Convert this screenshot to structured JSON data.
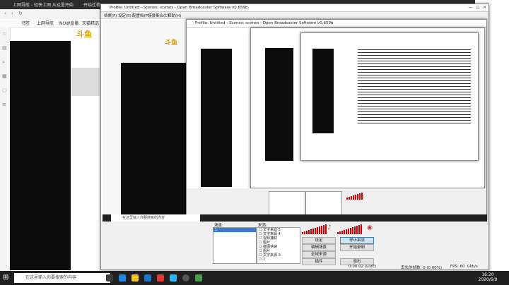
{
  "browser": {
    "tab_label": "上网导航 - 轻快上网 从这里开始",
    "tab_label2": "开始迁移",
    "bookmarks": [
      "书签",
      "上网导航",
      "NOW直播",
      "天猫精选"
    ],
    "logo": "斗鱼"
  },
  "obs": {
    "title": "Profile: Untitled - Scenes: scenes - Open Broadcaster Software v0.659b",
    "menu": [
      "档案(F)",
      "设定(S)",
      "配置档(P)",
      "场景集合(C)",
      "帮助(H)"
    ],
    "scenes_label": "场景:",
    "sources_label": "来源:",
    "scene_item": "1",
    "sources": [
      "文字来源 5",
      "文字来源 4",
      "视频捕获",
      "图片",
      "截图快速",
      "图片",
      "文字来源 3",
      "1",
      "文字来源 2"
    ],
    "buttons": {
      "settings": "设定",
      "stop_stream": "停止串流",
      "edit_scene": "编辑场景",
      "start_record": "开始录制",
      "global_sources": "全域来源",
      "plugins": "插件",
      "exit": "退出"
    },
    "status": {
      "time": "0:00:02 (LIVE)",
      "dropped": "丢失的帧数: 0 (0.00%)",
      "fps": "FPS: 60",
      "kbps": "0kb/s"
    }
  },
  "taskbar": {
    "search_placeholder": "在这里输入你要搜索的内容",
    "time": "16:20",
    "date": "2020/6/9"
  },
  "colors": {
    "meter_red": "#cc0000",
    "obs_accent": "#d32f2f"
  }
}
